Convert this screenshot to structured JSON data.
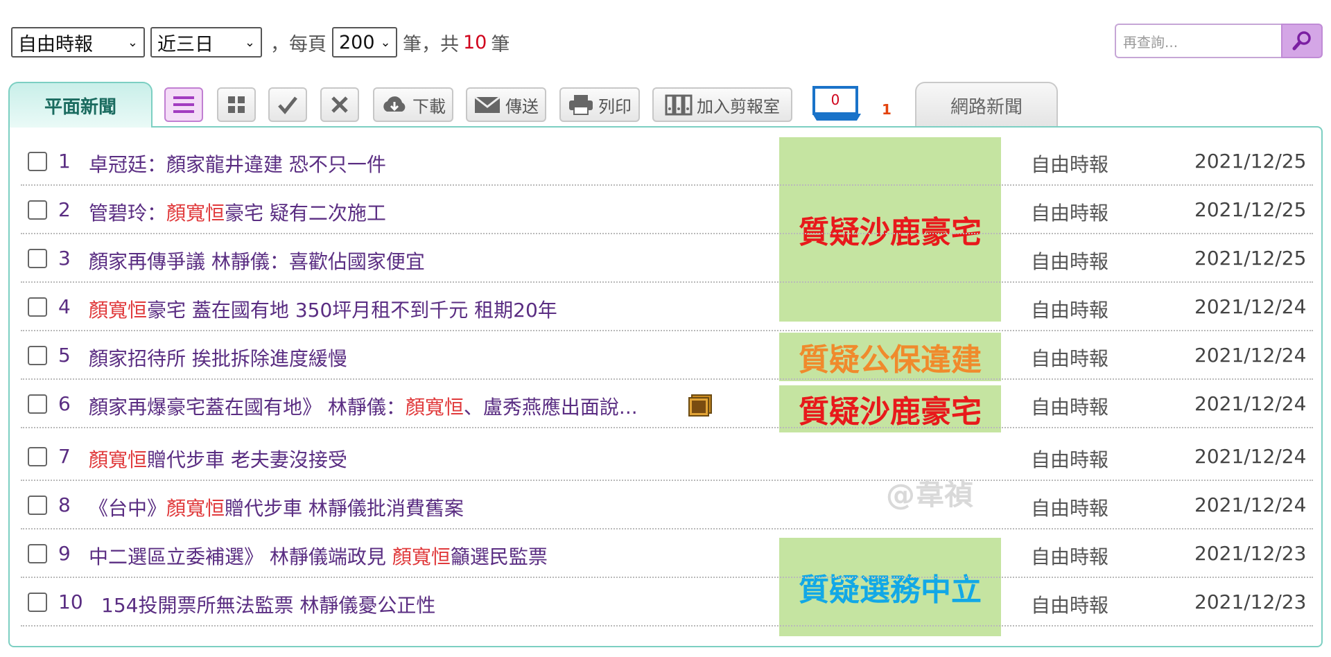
{
  "toolbar": {
    "source": "自由時報",
    "range": "近三日",
    "per_page_prefix": "，每頁",
    "per_page": "200",
    "count_prefix": "筆，共",
    "total": "10",
    "count_suffix": "筆"
  },
  "search": {
    "placeholder": "再查詢..."
  },
  "tabs": {
    "print": "平面新聞",
    "web": "網路新聞"
  },
  "actions": {
    "download": "下載",
    "send": "傳送",
    "print": "列印",
    "clip": "加入剪報室",
    "folder_count": "0",
    "folder_badge": "1"
  },
  "rows": [
    {
      "num": "1",
      "segments": [
        {
          "t": "卓冠廷：顏家龍井違建 恐不只一件",
          "h": false
        }
      ],
      "source": "自由時報",
      "date": "2021/12/25"
    },
    {
      "num": "2",
      "segments": [
        {
          "t": "管碧玲：",
          "h": false
        },
        {
          "t": "顏寬恒",
          "h": true
        },
        {
          "t": "豪宅 疑有二次施工",
          "h": false
        }
      ],
      "source": "自由時報",
      "date": "2021/12/25"
    },
    {
      "num": "3",
      "segments": [
        {
          "t": "顏家再傳爭議 林靜儀：喜歡佔國家便宜",
          "h": false
        }
      ],
      "source": "自由時報",
      "date": "2021/12/25"
    },
    {
      "num": "4",
      "segments": [
        {
          "t": "顏寬恒",
          "h": true
        },
        {
          "t": "豪宅 蓋在國有地 350坪月租不到千元 租期20年",
          "h": false
        }
      ],
      "source": "自由時報",
      "date": "2021/12/24"
    },
    {
      "num": "5",
      "segments": [
        {
          "t": "顏家招待所 挨批拆除進度緩慢",
          "h": false
        }
      ],
      "source": "自由時報",
      "date": "2021/12/24"
    },
    {
      "num": "6",
      "segments": [
        {
          "t": "顏家再爆豪宅蓋在國有地》 林靜儀：",
          "h": false
        },
        {
          "t": "顏寬恒",
          "h": true
        },
        {
          "t": "、盧秀燕應出面說...",
          "h": false
        }
      ],
      "source": "自由時報",
      "date": "2021/12/24",
      "photo": true
    },
    {
      "num": "7",
      "segments": [
        {
          "t": "顏寬恒",
          "h": true
        },
        {
          "t": "贈代步車 老夫妻沒接受",
          "h": false
        }
      ],
      "source": "自由時報",
      "date": "2021/12/24"
    },
    {
      "num": "8",
      "segments": [
        {
          "t": "《台中》",
          "h": false
        },
        {
          "t": "顏寬恒",
          "h": true
        },
        {
          "t": "贈代步車 林靜儀批消費舊案",
          "h": false
        }
      ],
      "source": "自由時報",
      "date": "2021/12/24"
    },
    {
      "num": "9",
      "segments": [
        {
          "t": "中二選區立委補選》 林靜儀端政見 ",
          "h": false
        },
        {
          "t": "顏寬恒",
          "h": true
        },
        {
          "t": "籲選民監票",
          "h": false
        }
      ],
      "source": "自由時報",
      "date": "2021/12/23"
    },
    {
      "num": "10",
      "segments": [
        {
          "t": "154投開票所無法監票 林靜儀憂公正性",
          "h": false
        }
      ],
      "source": "自由時報",
      "date": "2021/12/23"
    }
  ],
  "annotations": [
    {
      "text": "質疑沙鹿豪宅",
      "color": "#e8191b"
    },
    {
      "text": "質疑公保違建",
      "color": "#f08a2c"
    },
    {
      "text": "質疑沙鹿豪宅",
      "color": "#e8191b"
    },
    {
      "text": "質疑選務中立",
      "color": "#12a8e6"
    }
  ],
  "watermark": "@韋禎"
}
